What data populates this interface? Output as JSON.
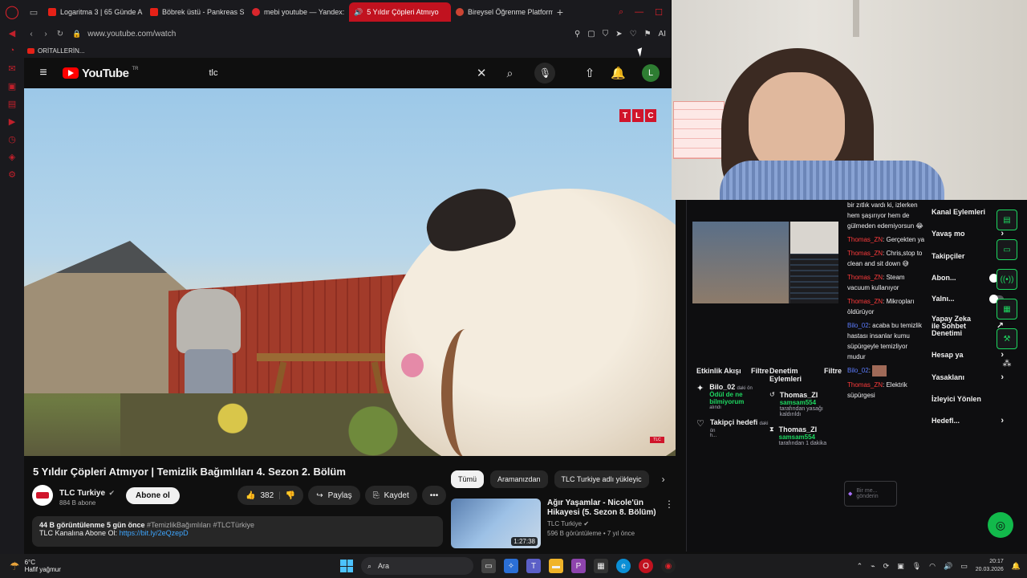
{
  "browser": {
    "tabs": [
      {
        "label": "Logaritma 3 | 65 Günde A"
      },
      {
        "label": "Böbrek üstü - Pankreas S"
      },
      {
        "label": "mebi youtube — Yandex:"
      },
      {
        "label": "5 Yıldır Çöpleri Atmıyo"
      },
      {
        "label": "Bireysel Öğrenme Platform"
      }
    ],
    "url": "www.youtube.com/watch",
    "bookmark_label": "ORİTALLERİN...",
    "ai_label": "AI"
  },
  "youtube": {
    "logo_text": "YouTube",
    "logo_region": "TR",
    "search_value": "tlc",
    "avatar_letter": "L",
    "video": {
      "overlay_logo": [
        "T",
        "L",
        "C"
      ],
      "corner_logo": "TLC"
    },
    "title": "5 Yıldır Çöpleri Atmıyor | Temizlik Bağımlıları 4. Sezon 2. Bölüm",
    "channel": {
      "name": "TLC Turkiye",
      "subs": "884 B abone",
      "subscribe_label": "Abone ol"
    },
    "actions": {
      "likes": "382",
      "share": "Paylaş",
      "save": "Kaydet",
      "more": "•••"
    },
    "description": {
      "meta": "44 B görüntülenme  5 gün önce",
      "tags": "#TemizlikBağımlıları #TLCTürkiye",
      "line2_prefix": "TLC Kanalına Abone Ol: ",
      "link": "https://bit.ly/2eQzepD"
    },
    "chips": [
      "Tümü",
      "Aramanızdan",
      "TLC Turkiye adlı yükleyic"
    ],
    "recommendation": {
      "title": "Ağır Yaşamlar - Nicole'ün Hikayesi (5. Sezon 8. Bölüm)",
      "channel": "TLC Turkiye",
      "meta": "596 B görüntüleme • 7 yıl önce",
      "duration": "1:27:38"
    }
  },
  "stream_panel": {
    "activity": {
      "title": "Etkinlik Akışı",
      "filter": "Filtre",
      "items": [
        {
          "name": "Bilo_02",
          "time": "daki ön",
          "detail": "Ödül de ne bilmiyorum",
          "note": "alındı"
        },
        {
          "name": "Takipçi hedefi",
          "time": "daki ön",
          "detail": "h..."
        }
      ]
    },
    "moderation": {
      "title": "Denetim Eylemleri",
      "filter": "Filtre",
      "items": [
        {
          "name": "Thomas_ZI",
          "actor": "samsam554",
          "text": "tarafından yasağı kaldırıldı"
        },
        {
          "name": "Thomas_ZI",
          "actor": "samsam554",
          "text": "tarafından 1 dakika"
        }
      ]
    },
    "chat": [
      {
        "user": "",
        "text": "bir zıtlık vardı ki, izlerken hem şaşırıyor hem de gülmeden edemiyorsun 😂"
      },
      {
        "user": "Thomas_ZN",
        "text": "Gerçekten ya"
      },
      {
        "user": "Thomas_ZN",
        "text": "Chris,stop to clean and sit down 😅"
      },
      {
        "user": "Thomas_ZN",
        "text": "Steam vacuum kullanıyor"
      },
      {
        "user": "Thomas_ZN",
        "text": "Mikropları öldürüyor"
      },
      {
        "user": "Bilo_02",
        "text": "acaba bu temizlik hastası insanlar kumu süpürgeyle temizliyor mudur"
      },
      {
        "user": "Bilo_02",
        "text": ""
      },
      {
        "user": "Thomas_ZN",
        "text": "Elektrik süpürgesi"
      }
    ],
    "chat_placeholder": "Bir me... gönderin",
    "kanal": {
      "title": "Kanal Eylemleri",
      "rows": [
        {
          "label": "Yavaş mo",
          "control": "chevron"
        },
        {
          "label": "Takipçiler",
          "control": "chevron"
        },
        {
          "label": "Abon...",
          "control": "toggle"
        },
        {
          "label": "Yalnı...",
          "control": "toggle"
        },
        {
          "label": "Yapay Zeka ile Sohbet Denetimi",
          "control": "link"
        },
        {
          "label": "Hesap ya",
          "control": "chevron"
        },
        {
          "label": "Yasaklanı",
          "control": "chevron"
        },
        {
          "label": "İzleyici Yönlen",
          "control": "none"
        },
        {
          "label": "Hedefl...",
          "control": "chevron"
        }
      ]
    }
  },
  "taskbar": {
    "temp": "6°C",
    "weather": "Hafif yağmur",
    "search_label": "Ara",
    "time": "20:17",
    "date": "20.03.2026"
  }
}
